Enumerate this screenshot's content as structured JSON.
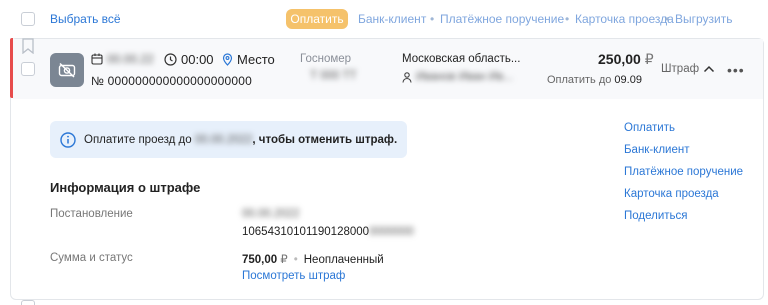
{
  "toolbar": {
    "select_all_label": "Выбрать всё",
    "pay_label": "Оплатить",
    "actions": [
      "Банк-клиент",
      "Платёжное поручение",
      "Карточка проезда",
      "Выгрузить"
    ],
    "separator": "•"
  },
  "fine": {
    "date": "00.00.22",
    "time": "00:00",
    "place": "Место",
    "number_label": "№",
    "number": "000000000000000000000",
    "plate_label": "Госномер",
    "plate_value": "Т 000 ТТ",
    "region": "Московская область...",
    "owner": "Иванов Иван Ив...",
    "amount_value": "250,00",
    "amount_currency": "₽",
    "pay_until_label": "Оплатить до",
    "pay_until_date": "09.09",
    "type": "Штраф"
  },
  "notice": {
    "prefix": "Оплатите проезд до",
    "date": "00.00.2022",
    "suffix": ", чтобы отменить штраф."
  },
  "info": {
    "title": "Информация о штрафе",
    "decree_label": "Постановление",
    "decree_date": "00.00.2022",
    "decree_number": "10654310101190128000",
    "decree_number_hidden": "0000000",
    "sum_label": "Сумма и статус",
    "sum_value": "750,00",
    "sum_currency": "₽",
    "status": "Неоплаченный",
    "view_link": "Посмотреть штраф"
  },
  "side_actions": [
    "Оплатить",
    "Банк-клиент",
    "Платёжное поручение",
    "Карточка проезда",
    "Поделиться"
  ],
  "colors": {
    "accent": "#2b77d6",
    "pay_button": "#f5c26b",
    "unpaid_marker": "#e74c4c",
    "notice_bg": "#e7f0fb"
  },
  "icons": {
    "calendar": "calendar-icon",
    "clock": "clock-icon",
    "location": "location-pin-icon",
    "person": "person-icon",
    "camera_off": "camera-off-icon",
    "info": "info-icon",
    "chevron": "chevron-up-icon",
    "more": "more-dots-icon",
    "bookmark": "bookmark-icon"
  }
}
